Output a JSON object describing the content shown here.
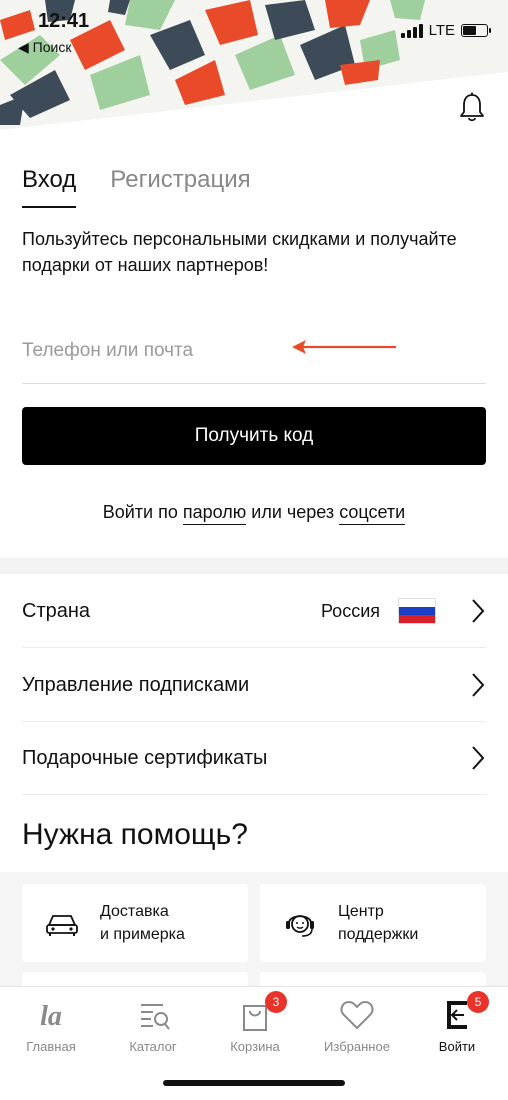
{
  "status_bar": {
    "time": "12:41",
    "back_label": "◀ Поиск",
    "network": "LTE",
    "battery_level": 0.55
  },
  "banner": {
    "colors": [
      "#e84a2a",
      "#3d4b58",
      "#9fcf9d"
    ]
  },
  "tabs": [
    {
      "label": "Вход",
      "active": true
    },
    {
      "label": "Регистрация",
      "active": false
    }
  ],
  "promo_text": "Пользуйтесь персональными скидками и получайте подарки от наших партнеров!",
  "login_field": {
    "placeholder": "Телефон или почта",
    "value": ""
  },
  "get_code_label": "Получить код",
  "alt_login": {
    "prefix": "Войти по",
    "password_link": "паролю",
    "middle": "или через",
    "social_link": "соцсети"
  },
  "settings": [
    {
      "label": "Страна",
      "value": "Россия"
    },
    {
      "label": "Управление подписками",
      "value": ""
    },
    {
      "label": "Подарочные сертификаты",
      "value": ""
    }
  ],
  "help": {
    "title": "Нужна помощь?",
    "cards": [
      {
        "line1": "Доставка",
        "line2": "и примерка",
        "icon": "car-icon"
      },
      {
        "line1": "Центр",
        "line2": "поддержки",
        "icon": "headset-icon"
      }
    ]
  },
  "bottom_nav": [
    {
      "label": "Главная",
      "icon": "home-logo-icon",
      "badge": ""
    },
    {
      "label": "Каталог",
      "icon": "catalog-search-icon",
      "badge": ""
    },
    {
      "label": "Корзина",
      "icon": "bag-icon",
      "badge": "3"
    },
    {
      "label": "Избранное",
      "icon": "heart-icon",
      "badge": ""
    },
    {
      "label": "Войти",
      "icon": "login-door-icon",
      "badge": "5"
    }
  ],
  "colors": {
    "accent_red": "#e8332b",
    "annotation_arrow": "#e84a2a",
    "button_bg": "#000000"
  }
}
